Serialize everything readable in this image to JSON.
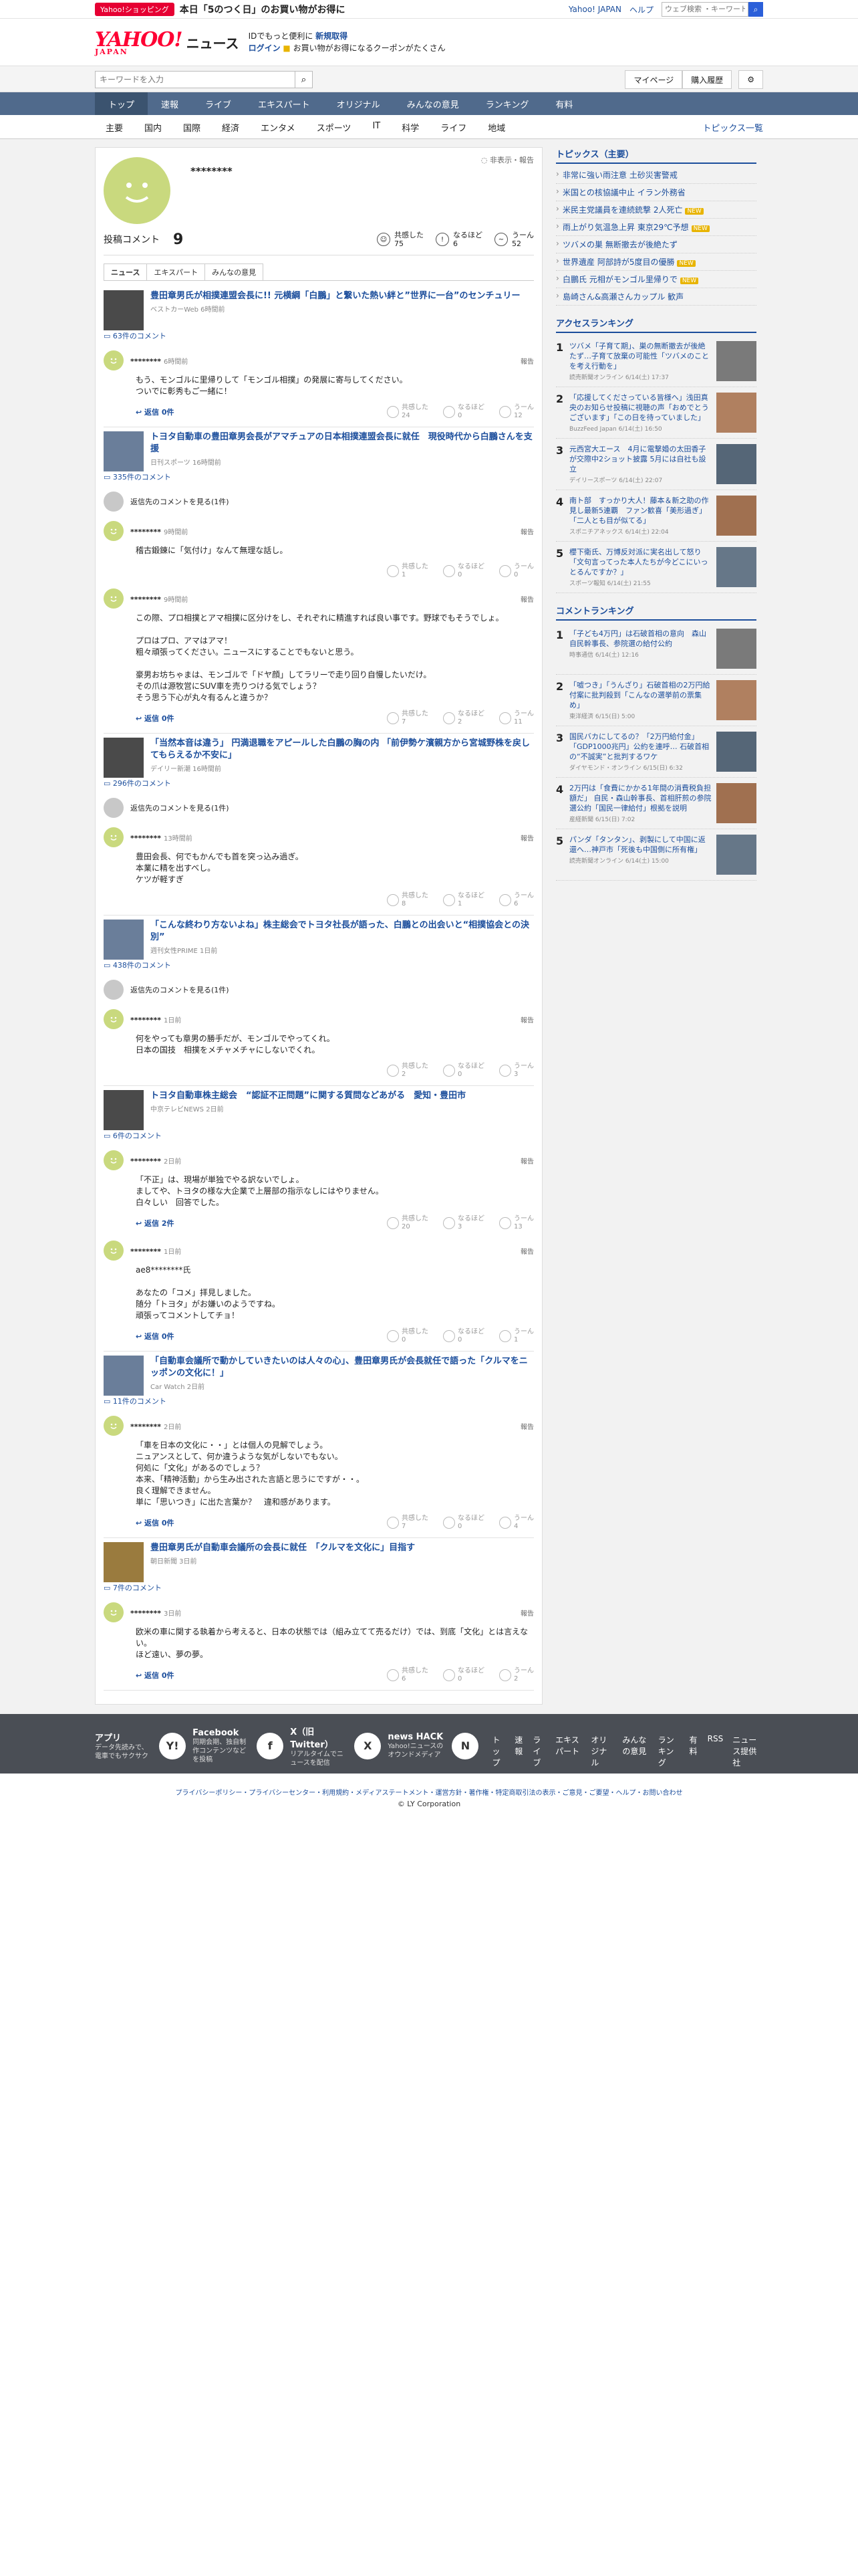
{
  "promo": {
    "badge": "Yahoo!ショッピング",
    "text": "本日「5のつく日」のお買い物がお得に",
    "links": [
      "Yahoo! JAPAN",
      "ヘルプ"
    ],
    "search_placeholder": "ウェブ検索 ・キーワードを入"
  },
  "masthead": {
    "logo": "YAHOO!",
    "logo_sub": "JAPAN",
    "section": "ニュース",
    "info_line1": "IDでもっと便利に",
    "info_line1_link": "新規取得",
    "info_login": "ログイン",
    "info_line2": "お買い物がお得になるクーポンがたくさん"
  },
  "searchrow": {
    "placeholder": "キーワードを入力",
    "mypage": "マイページ",
    "history": "購入履歴"
  },
  "mainnav": [
    "トップ",
    "速報",
    "ライブ",
    "エキスパート",
    "オリジナル",
    "みんなの意見",
    "ランキング",
    "有料"
  ],
  "subnav": {
    "items": [
      "主要",
      "国内",
      "国際",
      "経済",
      "エンタメ",
      "スポーツ",
      "IT",
      "科学",
      "ライフ",
      "地域"
    ],
    "right": "トピックス一覧"
  },
  "profile": {
    "name": "********",
    "topright": "非表示・報告",
    "comments_label": "投稿コメント",
    "comments_count": "9",
    "reactions": [
      {
        "label": "共感した",
        "count": "75"
      },
      {
        "label": "なるほど",
        "count": "6"
      },
      {
        "label": "うーん",
        "count": "52"
      }
    ]
  },
  "tabs": [
    "ニュース",
    "エキスパート",
    "みんなの意見"
  ],
  "reply_label": "返信",
  "report_label": "報告",
  "articles": [
    {
      "title": "豊田章男氏が相撲連盟会長に!! 元横綱「白鵬」と繋いた熱い絆と”世界に一台”のセンチュリー",
      "src": "ベストカーWeb 6時間前",
      "count": "63件のコメント",
      "replies_summary": "",
      "comments": [
        {
          "user": "********",
          "time": "6時間前",
          "body": "もう、モンゴルに里帰りして「モンゴル相撲」の発展に寄与してください。\nついでに彰秀もご一緒に！",
          "reply": "返信 0件",
          "r": [
            "24",
            "0",
            "12"
          ]
        }
      ]
    },
    {
      "title": "トヨタ自動車の豊田章男会長がアマチュアの日本相撲連盟会長に就任　現役時代から白鵬さんを支援",
      "src": "日刊スポーツ 16時間前",
      "count": "335件のコメント",
      "replies_summary": "返信先のコメントを見る(1件)",
      "comments": [
        {
          "user": "********",
          "time": "9時間前",
          "body": "稽古鍛錬に「気付け」なんて無理な話し。",
          "reply": "",
          "r": [
            "1",
            "0",
            "0"
          ]
        },
        {
          "user": "********",
          "time": "9時間前",
          "body": "この際、プロ相撲とアマ相撲に区分けをし、それぞれに精進すれば良い事です。野球でもそうでしょ。\n\nプロはプロ、アマはアマ！\n粗々頑張ってください。ニュースにすることでもないと思う。\n\n豪男お坊ちゃまは、モンゴルで「ドヤ顔」してラリーで走り回り自慢したいだけ。\nその爪は源牧営にSUV車を売りつける気でしょう？\nそう思う下心が丸々有るんと違うか？",
          "reply": "返信 0件",
          "r": [
            "7",
            "2",
            "11"
          ]
        }
      ]
    },
    {
      "title": "「当然本音は違う」 円満退職をアピールした白鵬の胸の内 「前伊勢ケ濱親方から宮城野株を戻してもらえるか不安に」",
      "src": "デイリー新潮 16時間前",
      "count": "296件のコメント",
      "replies_summary": "返信先のコメントを見る(1件)",
      "comments": [
        {
          "user": "********",
          "time": "13時間前",
          "body": "豊田会長、何でもかんでも首を突っ込み過ぎ。\n本業に精を出すべし。\nケツが軽すぎ",
          "reply": "",
          "r": [
            "8",
            "1",
            "6"
          ]
        }
      ]
    },
    {
      "title": "「こんな終わり方ないよね」株主総会でトヨタ社長が語った、白鵬との出会いと“相撲協会との決別”",
      "src": "週刊女性PRIME 1日前",
      "count": "438件のコメント",
      "replies_summary": "返信先のコメントを見る(1件)",
      "comments": [
        {
          "user": "********",
          "time": "1日前",
          "body": "何をやっても章男の勝手だが、モンゴルでやってくれ。\n日本の国技　相撲をメチャメチャにしないでくれ。",
          "reply": "",
          "r": [
            "2",
            "0",
            "3"
          ]
        }
      ]
    },
    {
      "title": "トヨタ自動車株主総会　“認証不正問題”に関する質問などあがる　愛知・豊田市",
      "src": "中京テレビNEWS 2日前",
      "count": "6件のコメント",
      "replies_summary": "",
      "comments": [
        {
          "user": "********",
          "time": "2日前",
          "body": "「不正」は、現場が単独でやる訳ないでしょ。\nましてや、トヨタの様な大企業で上層部の指示なしにはやりません。\n白々しい　回答でした。",
          "reply": "返信 2件",
          "r": [
            "20",
            "3",
            "13"
          ]
        },
        {
          "user": "********",
          "time": "1日前",
          "body": "ae8********氏\n\nあなたの「コメ」拝見しました。\n随分「トヨタ」がお嫌いのようですね。\n頑張ってコメントしてチョ！",
          "reply": "返信 0件",
          "r": [
            "0",
            "0",
            "1"
          ]
        }
      ]
    },
    {
      "title": "「自動車会議所で動かしていきたいのは人々の心」、豊田章男氏が会長就任で語った「クルマをニッポンの文化に！」",
      "src": "Car Watch 2日前",
      "count": "11件のコメント",
      "replies_summary": "",
      "comments": [
        {
          "user": "********",
          "time": "2日前",
          "body": "「車を日本の文化に・・」とは個人の見解でしょう。\nニュアンスとして、何か違うような気がしないでもない。\n何処に「文化」があるのでしょう？\n本来、「精神活動」から生み出された言語と思うにですが・・。\n良く理解できません。\n単に「思いつき」に出た言葉か？　違和感があります。",
          "reply": "返信 0件",
          "r": [
            "7",
            "0",
            "4"
          ]
        }
      ]
    },
    {
      "title": "豊田章男氏が自動車会議所の会長に就任　「クルマを文化に」目指す",
      "src": "朝日新聞 3日前",
      "count": "7件のコメント",
      "replies_summary": "",
      "comments": [
        {
          "user": "********",
          "time": "3日前",
          "body": "欧米の車に関する執着から考えると、日本の状態では（組み立てて売るだけ）では、到底「文化」とは言えない。\nほど遠い、夢の夢。",
          "reply": "返信 0件",
          "r": [
            "6",
            "0",
            "2"
          ]
        }
      ]
    }
  ],
  "sidebar": {
    "topics_h": "トピックス（主要）",
    "topics": [
      {
        "t": "非常に強い雨注意 土砂災害警戒",
        "b": ""
      },
      {
        "t": "米国との核協議中止 イラン外務省",
        "b": ""
      },
      {
        "t": "米民主党議員を連続銃撃 2人死亡",
        "b": "NEW"
      },
      {
        "t": "雨上がり気温急上昇 東京29℃予想",
        "b": "NEW"
      },
      {
        "t": "ツバメの巣 無断撤去が後絶たず",
        "b": ""
      },
      {
        "t": "世界遺産 阿部詩が5度目の優勝",
        "b": "NEW"
      },
      {
        "t": "白鵬氏 元相がモンゴル里帰りで",
        "b": "NEW"
      },
      {
        "t": "島崎さん&高瀬さんカップル 歓声",
        "b": ""
      }
    ],
    "access_h": "アクセスランキング",
    "access": [
      {
        "t": "ツバメ「子育て期」、巣の無断撤去が後絶たず…子育て放棄の可能性「ツバメのことを考え行動を」",
        "s": "読売新聞オンライン 6/14(土) 17:37"
      },
      {
        "t": "「応援してくださっている皆様へ」浅田真央のお知らせ投稿に視聴の声「おめでとうございます」「この日を待っていました」",
        "s": "BuzzFeed Japan 6/14(土) 16:50"
      },
      {
        "t": "元西宮大エース　4月に電撃婚の太田香子が交際中2ショット披露 5月には自社も設立",
        "s": "デイリースポーツ 6/14(土) 22:07"
      },
      {
        "t": "南ト部　すっかり大人！藤本＆新之助の作見し最新5連覇　ファン歓喜「美形過ぎ」「二人とも目が似てる」",
        "s": "スポニチアネックス 6/14(土) 22:04"
      },
      {
        "t": "櫻下衛氏、万博反対派に実名出して怒り「文句言ってった本人たちが今どこにいっとるんですか？」",
        "s": "スポーツ報知 6/14(土) 21:55"
      }
    ],
    "comment_h": "コメントランキング",
    "comment": [
      {
        "t": "「子ども4万円」は石破首相の意向　森山自民幹事長、参院選の給付公約",
        "s": "時事通信 6/14(土) 12:16"
      },
      {
        "t": "「嘘つき」「うんざり」石破首相の2万円給付案に批判殺到「こんなの選挙前の票集め」",
        "s": "東洋経済 6/15(日) 5:00"
      },
      {
        "t": "国民バカにしてるの？「2万円給付金」「GDP1000兆円」公約を連呼… 石破首相の“不誠実”と批判するワケ",
        "s": "ダイヤモンド・オンライン 6/15(日) 6:32"
      },
      {
        "t": "2万円は「食費にかかる1年間の消費税負担額だ」 自民・森山幹事長、首相肝煎の参院選公約「国民一律給付」根拠を説明",
        "s": "産経新聞 6/15(日) 7:02"
      },
      {
        "t": "パンダ「タンタン」、剥製にして中国に返還へ…神戸市「死後も中国側に所有権」",
        "s": "読売新聞オンライン 6/14(土) 15:00"
      }
    ]
  },
  "footer": {
    "cols": [
      {
        "h": "アプリ",
        "d": "データ先読みで、電車でもサクサク",
        "ico": "Y!"
      },
      {
        "h": "Facebook",
        "d": "同期会期、独自制作コンテンツなどを投稿",
        "ico": "f"
      },
      {
        "h": "X（旧Twitter）",
        "d": "リアルタイムでニュースを配信",
        "ico": "X"
      },
      {
        "h": "news HACK",
        "d": "Yahoo!ニュースのオウンドメディア",
        "ico": "N"
      }
    ],
    "links": [
      "トップ",
      "速報",
      "ライブ",
      "エキスパート",
      "オリジナル",
      "みんなの意見",
      "ランキング",
      "有料",
      "RSS",
      "ニュース提供社"
    ],
    "legal": "プライバシーポリシー・プライバシーセンター・利用規約・メディアステートメント・運営方針・著作権・特定商取引法の表示・ご意見・ご要望・ヘルプ・お問い合わせ",
    "copy": "© LY Corporation"
  }
}
